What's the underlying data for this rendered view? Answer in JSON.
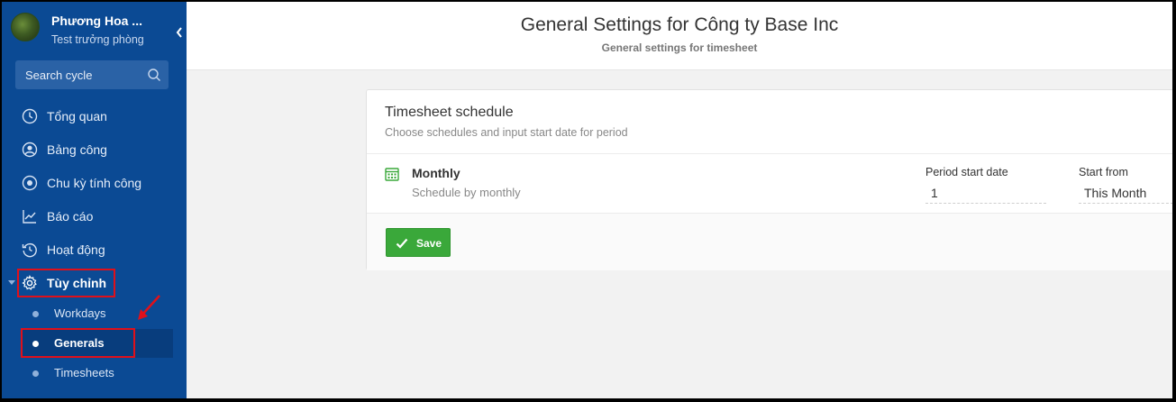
{
  "user": {
    "name": "Phương Hoa ...",
    "role": "Test trưởng phòng"
  },
  "search": {
    "placeholder": "Search cycle"
  },
  "nav": {
    "items": [
      {
        "label": "Tổng quan",
        "icon": "clock-icon"
      },
      {
        "label": "Bảng công",
        "icon": "user-circle-icon"
      },
      {
        "label": "Chu kỳ tính công",
        "icon": "target-icon"
      },
      {
        "label": "Báo cáo",
        "icon": "chart-line-icon"
      },
      {
        "label": "Hoạt động",
        "icon": "history-icon"
      },
      {
        "label": "Tùy chỉnh",
        "icon": "gear-icon"
      }
    ],
    "sub_items": [
      {
        "label": "Workdays"
      },
      {
        "label": "Generals"
      },
      {
        "label": "Timesheets"
      }
    ]
  },
  "header": {
    "title": "General Settings for Công ty Base Inc",
    "subtitle": "General settings for timesheet"
  },
  "card": {
    "title": "Timesheet schedule",
    "subtitle": "Choose schedules and input start date for period",
    "schedule": {
      "title": "Monthly",
      "description": "Schedule by monthly"
    },
    "period_start_label": "Period start date",
    "period_start_value": "1",
    "start_from_label": "Start from",
    "start_from_value": "This Month",
    "save_label": "Save"
  },
  "colors": {
    "sidebar_bg": "#0b4a94",
    "save_green": "#3aa83a",
    "annotation_red": "#e0101a"
  }
}
